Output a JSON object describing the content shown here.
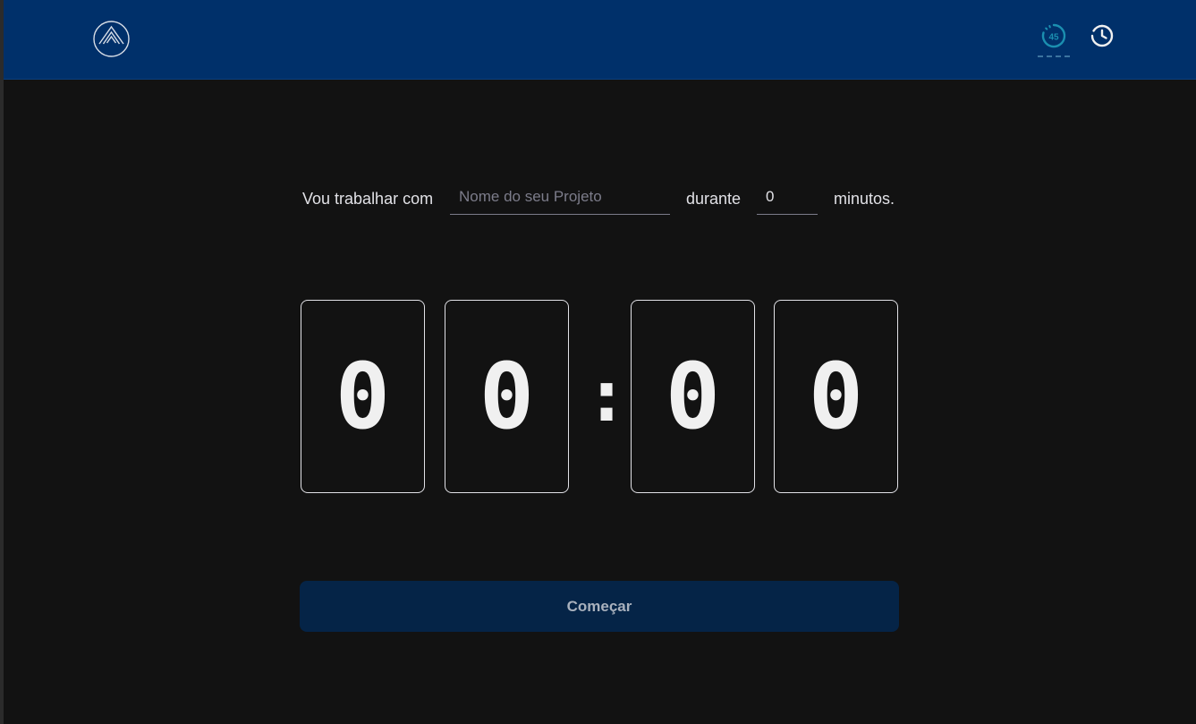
{
  "header": {
    "logo_icon": "mountain-logo-icon",
    "nav": {
      "timer_icon": "timer-45-icon",
      "timer_badge": "45",
      "timer_active_color": "#1b8fb0",
      "history_icon": "clock-history-icon"
    },
    "background_color": "#00306a"
  },
  "form": {
    "prefix": "Vou trabalhar com",
    "project_placeholder": "Nome do seu Projeto",
    "project_value": "",
    "middle": "durante",
    "minutes_value": "0",
    "suffix": "minutos."
  },
  "countdown": {
    "minutes_tens": "0",
    "minutes_ones": "0",
    "separator": ":",
    "seconds_tens": "0",
    "seconds_ones": "0"
  },
  "start_button": {
    "label": "Começar",
    "color": "#052447"
  }
}
